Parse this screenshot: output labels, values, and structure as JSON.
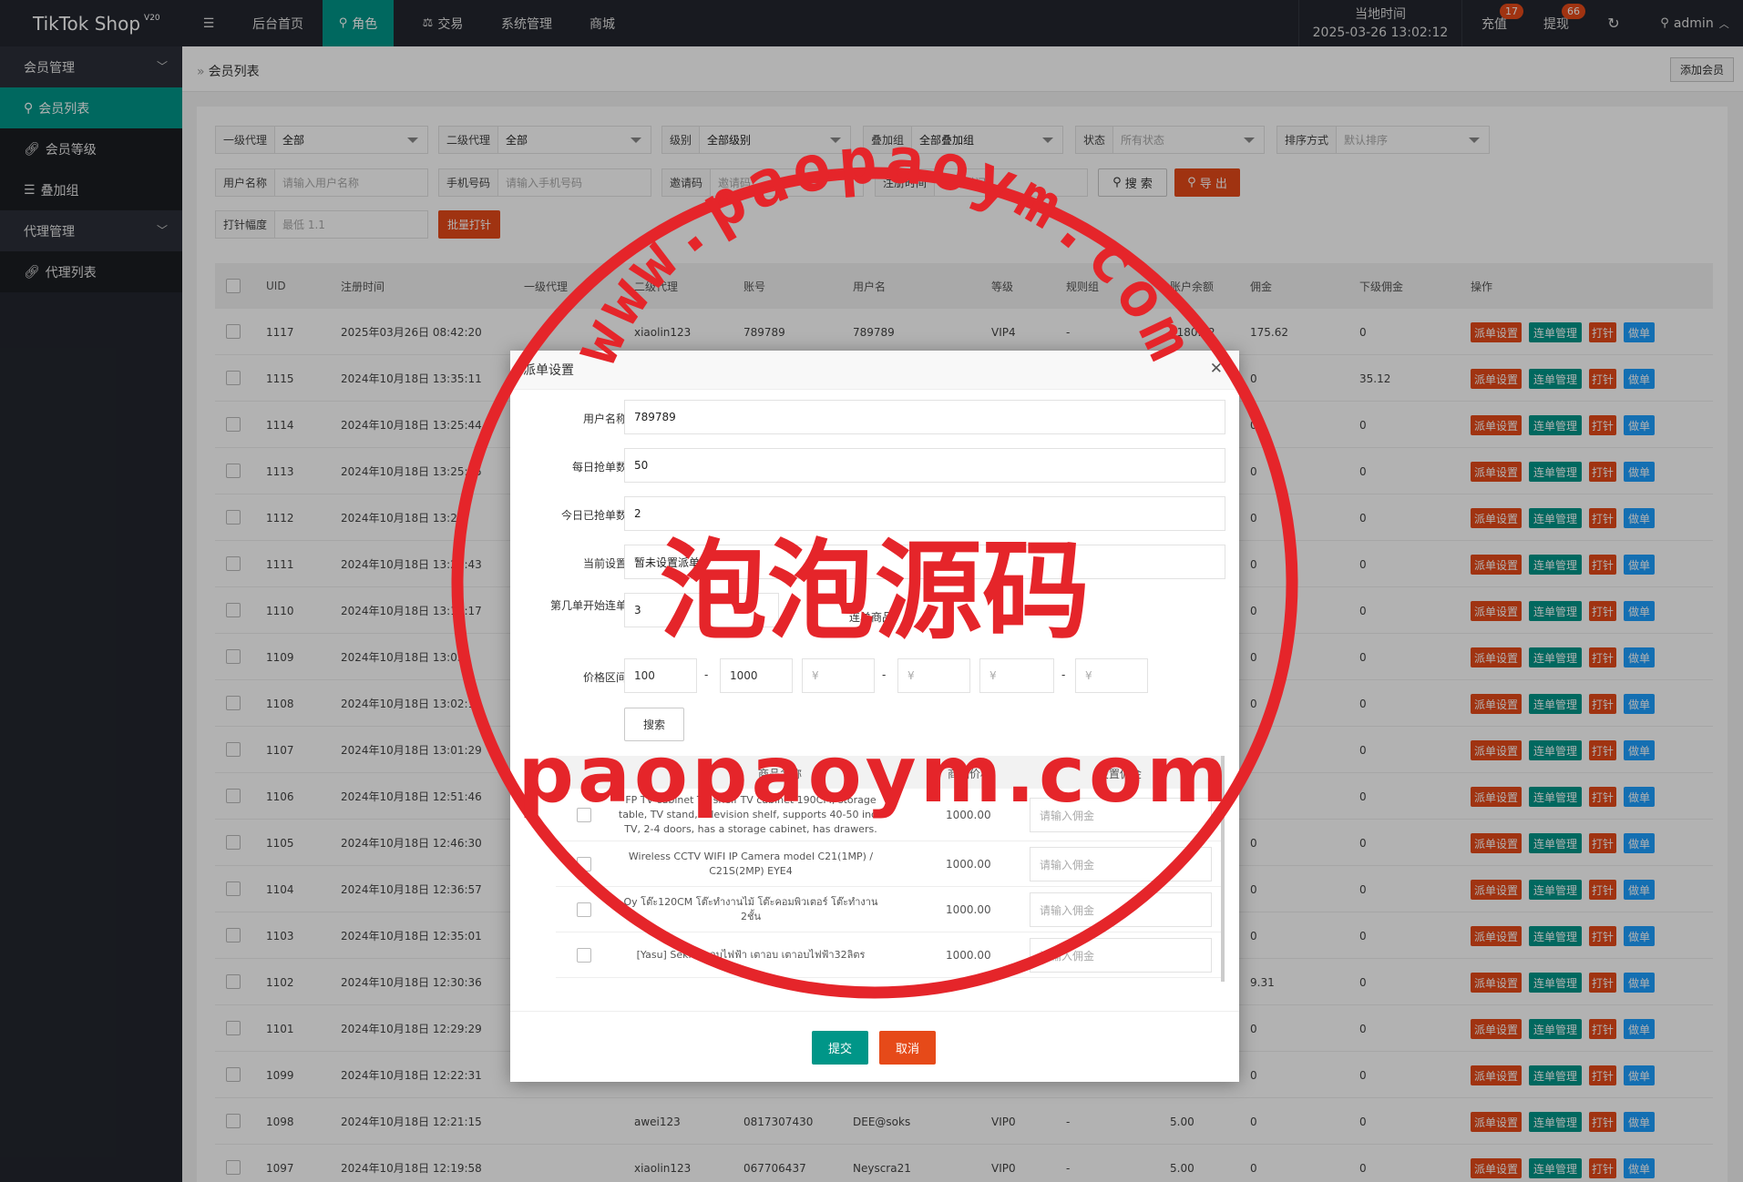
{
  "app": {
    "title": "TikTok Shop",
    "version": "V20"
  },
  "topnav": {
    "menu_icon": "menu-icon",
    "items": [
      {
        "label": "后台首页",
        "active": false
      },
      {
        "label": "角色",
        "icon": "user-icon",
        "active": true
      },
      {
        "label": "交易",
        "icon": "scale-icon",
        "active": false
      },
      {
        "label": "系统管理",
        "active": false
      },
      {
        "label": "商城",
        "active": false
      }
    ],
    "time_label": "当地时间",
    "time_value": "2025-03-26 13:02:12",
    "recharge_label": "充值",
    "recharge_badge": "17",
    "withdraw_label": "提现",
    "withdraw_badge": "66",
    "user_label": "admin"
  },
  "sidebar": {
    "groups": [
      {
        "label": "会员管理",
        "items": [
          {
            "label": "会员列表",
            "icon": "user-icon",
            "active": true
          },
          {
            "label": "会员等级",
            "icon": "link-icon",
            "active": false
          },
          {
            "label": "叠加组",
            "icon": "list-icon",
            "active": false
          }
        ]
      },
      {
        "label": "代理管理",
        "items": [
          {
            "label": "代理列表",
            "icon": "link-icon",
            "active": false
          }
        ]
      }
    ]
  },
  "breadcrumb": {
    "sep": "»",
    "current": "会员列表"
  },
  "add_member_label": "添加会员",
  "filters": {
    "agent1": {
      "label": "一级代理",
      "value": "全部"
    },
    "agent2": {
      "label": "二级代理",
      "value": "全部"
    },
    "level": {
      "label": "级别",
      "value": "全部级别"
    },
    "overlay_group": {
      "label": "叠加组",
      "value": "全部叠加组"
    },
    "status": {
      "label": "状态",
      "placeholder": "所有状态"
    },
    "sort": {
      "label": "排序方式",
      "placeholder": "默认排序"
    },
    "username": {
      "label": "用户名称",
      "placeholder": "请输入用户名称"
    },
    "phone": {
      "label": "手机号码",
      "placeholder": "请输入手机号码"
    },
    "invite": {
      "label": "邀请码",
      "placeholder": "邀请码"
    },
    "regtime": {
      "label": "注册时间",
      "placeholder": "注册时间"
    },
    "search_label": "搜 索",
    "export_label": "导 出",
    "needle": {
      "label": "打针幅度",
      "placeholder": "最低 1.1"
    },
    "batch_label": "批量打针"
  },
  "table": {
    "headers": [
      "UID",
      "注册时间",
      "一级代理",
      "二级代理",
      "账号",
      "用户名",
      "等级",
      "规则组",
      "账户余额",
      "佣金",
      "下级佣金",
      "操作"
    ],
    "actions": [
      "派单设置",
      "连单管理",
      "打针",
      "做单"
    ],
    "rows": [
      {
        "uid": "1117",
        "reg": "2025年03月26日 08:42:20",
        "a1": "",
        "a2": "xiaolin123",
        "acct": "789789",
        "name": "789789",
        "lvl": "VIP4",
        "rule": "-",
        "bal": "9180.62",
        "comm": "175.62",
        "sub": "0"
      },
      {
        "uid": "1115",
        "reg": "2024年10月18日 13:35:11",
        "a1": "",
        "a2": "",
        "acct": "",
        "name": "",
        "lvl": "",
        "rule": "",
        "bal": "",
        "comm": "0",
        "sub": "35.12"
      },
      {
        "uid": "1114",
        "reg": "2024年10月18日 13:25:44",
        "a1": "",
        "a2": "",
        "acct": "",
        "name": "",
        "lvl": "",
        "rule": "",
        "bal": "",
        "comm": "0",
        "sub": "0"
      },
      {
        "uid": "1113",
        "reg": "2024年10月18日 13:25:15",
        "a1": "",
        "a2": "",
        "acct": "",
        "name": "",
        "lvl": "",
        "rule": "",
        "bal": "",
        "comm": "0",
        "sub": "0"
      },
      {
        "uid": "1112",
        "reg": "2024年10月18日 13:23:",
        "a1": "",
        "a2": "",
        "acct": "",
        "name": "",
        "lvl": "",
        "rule": "",
        "bal": "",
        "comm": "0",
        "sub": "0"
      },
      {
        "uid": "1111",
        "reg": "2024年10月18日 13:21:43",
        "a1": "",
        "a2": "",
        "acct": "",
        "name": "",
        "lvl": "",
        "rule": "",
        "bal": "",
        "comm": "0",
        "sub": "0"
      },
      {
        "uid": "1110",
        "reg": "2024年10月18日 13:11:17",
        "a1": "",
        "a2": "",
        "acct": "",
        "name": "",
        "lvl": "",
        "rule": "",
        "bal": "",
        "comm": "0",
        "sub": "0"
      },
      {
        "uid": "1109",
        "reg": "2024年10月18日 13:03:",
        "a1": "",
        "a2": "",
        "acct": "",
        "name": "",
        "lvl": "",
        "rule": "",
        "bal": "",
        "comm": "0",
        "sub": "0"
      },
      {
        "uid": "1108",
        "reg": "2024年10月18日 13:02:1",
        "a1": "",
        "a2": "",
        "acct": "",
        "name": "",
        "lvl": "",
        "rule": "",
        "bal": "",
        "comm": "0",
        "sub": "0"
      },
      {
        "uid": "1107",
        "reg": "2024年10月18日 13:01:29",
        "a1": "",
        "a2": "",
        "acct": "",
        "name": "",
        "lvl": "",
        "rule": "",
        "bal": "",
        "comm": "",
        "sub": "0"
      },
      {
        "uid": "1106",
        "reg": "2024年10月18日 12:51:46",
        "a1": "",
        "a2": "",
        "acct": "",
        "name": "",
        "lvl": "",
        "rule": "",
        "bal": "",
        "comm": "",
        "sub": "0"
      },
      {
        "uid": "1105",
        "reg": "2024年10月18日 12:46:30",
        "a1": "",
        "a2": "",
        "acct": "",
        "name": "",
        "lvl": "",
        "rule": "",
        "bal": "",
        "comm": "0",
        "sub": "0"
      },
      {
        "uid": "1104",
        "reg": "2024年10月18日 12:36:57",
        "a1": "",
        "a2": "",
        "acct": "",
        "name": "",
        "lvl": "",
        "rule": "",
        "bal": "",
        "comm": "0",
        "sub": "0"
      },
      {
        "uid": "1103",
        "reg": "2024年10月18日 12:35:01",
        "a1": "",
        "a2": "",
        "acct": "",
        "name": "",
        "lvl": "",
        "rule": "",
        "bal": "",
        "comm": "0",
        "sub": "0"
      },
      {
        "uid": "1102",
        "reg": "2024年10月18日 12:30:36",
        "a1": "",
        "a2": "",
        "acct": "",
        "name": "",
        "lvl": "",
        "rule": "",
        "bal": "",
        "comm": "9.31",
        "sub": "0"
      },
      {
        "uid": "1101",
        "reg": "2024年10月18日 12:29:29",
        "a1": "",
        "a2": "",
        "acct": "",
        "name": "",
        "lvl": "",
        "rule": "",
        "bal": "",
        "comm": "0",
        "sub": "0"
      },
      {
        "uid": "1099",
        "reg": "2024年10月18日 12:22:31",
        "a1": "",
        "a2": "",
        "acct": "",
        "name": "",
        "lvl": "",
        "rule": "",
        "bal": "",
        "comm": "0",
        "sub": "0"
      },
      {
        "uid": "1098",
        "reg": "2024年10月18日 12:21:15",
        "a1": "",
        "a2": "awei123",
        "acct": "0817307430",
        "name": "DEE@soks",
        "lvl": "VIP0",
        "rule": "-",
        "bal": "5.00",
        "comm": "0",
        "sub": "0"
      },
      {
        "uid": "1097",
        "reg": "2024年10月18日 12:19:58",
        "a1": "",
        "a2": "xiaolin123",
        "acct": "067706437",
        "name": "Neyscra21",
        "lvl": "VIP0",
        "rule": "-",
        "bal": "5.00",
        "comm": "0",
        "sub": "0"
      }
    ]
  },
  "modal": {
    "title": "派单设置",
    "fields": [
      {
        "label": "用户名称",
        "value": "789789"
      },
      {
        "label": "每日抢单数",
        "value": "50"
      },
      {
        "label": "今日已抢单数",
        "value": "2"
      },
      {
        "label": "当前设置",
        "value": "暂未设置派单"
      }
    ],
    "start_label": "第几单开始连单",
    "start_value": "3",
    "combo_label": "连单商品",
    "price_label": "价格区间",
    "price_min": "100",
    "price_max": "1000",
    "price_ph": "¥",
    "dash": "-",
    "search_label": "搜索",
    "product_headers": [
      "商品名称",
      "商品价格",
      "设置佣金"
    ],
    "commission_ph": "请输入佣金",
    "products": [
      {
        "name": "FP TV cabinet TV shelf TV cabinet 190CM, storage table, TV stand, television shelf, supports 40-50 inch TV, 2-4 doors, has a storage cabinet, has drawers.",
        "price": "1000.00"
      },
      {
        "name": "Wireless CCTV WIFI IP Camera model C21(1MP) / C21S(2MP) EYE4",
        "price": "1000.00"
      },
      {
        "name": "Oy โต๊ะ120CM โต๊ะทำงานไม้ โต๊ะคอมพิวเตอร์ โต๊ะทำงาน 2ชั้น",
        "price": "1000.00"
      },
      {
        "name": "[Yasu] Seki เตาอบไฟฟ้า เตาอบ เตาอบไฟฟ้า32ลิตร",
        "price": "1000.00"
      }
    ],
    "submit_label": "提交",
    "cancel_label": "取消"
  },
  "watermark": {
    "top_text": "www.paopaoym.com",
    "chinese": "泡泡源码",
    "bottom_text": "paopaoym.com"
  },
  "colors": {
    "teal": "#009688",
    "orange": "#e64a19",
    "red": "#e5252a",
    "blue": "#1e9fff",
    "topbar": "#23262e"
  }
}
